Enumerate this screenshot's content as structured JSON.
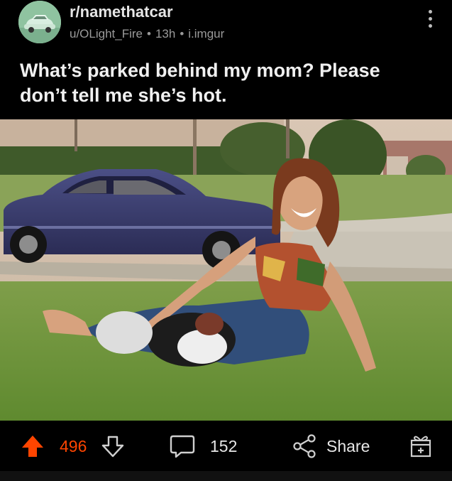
{
  "post": {
    "subreddit": "r/namethatcar",
    "author": "u/OLight_Fire",
    "time": "13h",
    "domain": "i.imgur",
    "title": "What’s parked behind my mom? Please don’t tell me she’s hot."
  },
  "actions": {
    "upvotes": "496",
    "comments": "152",
    "share_label": "Share"
  },
  "colors": {
    "upvote_active": "#ff4500",
    "text_primary": "#f0f0f0",
    "text_muted": "#9a9a9a"
  },
  "icons": [
    "kebab-menu-icon",
    "upvote-icon",
    "downvote-icon",
    "comment-icon",
    "share-icon",
    "award-icon"
  ]
}
